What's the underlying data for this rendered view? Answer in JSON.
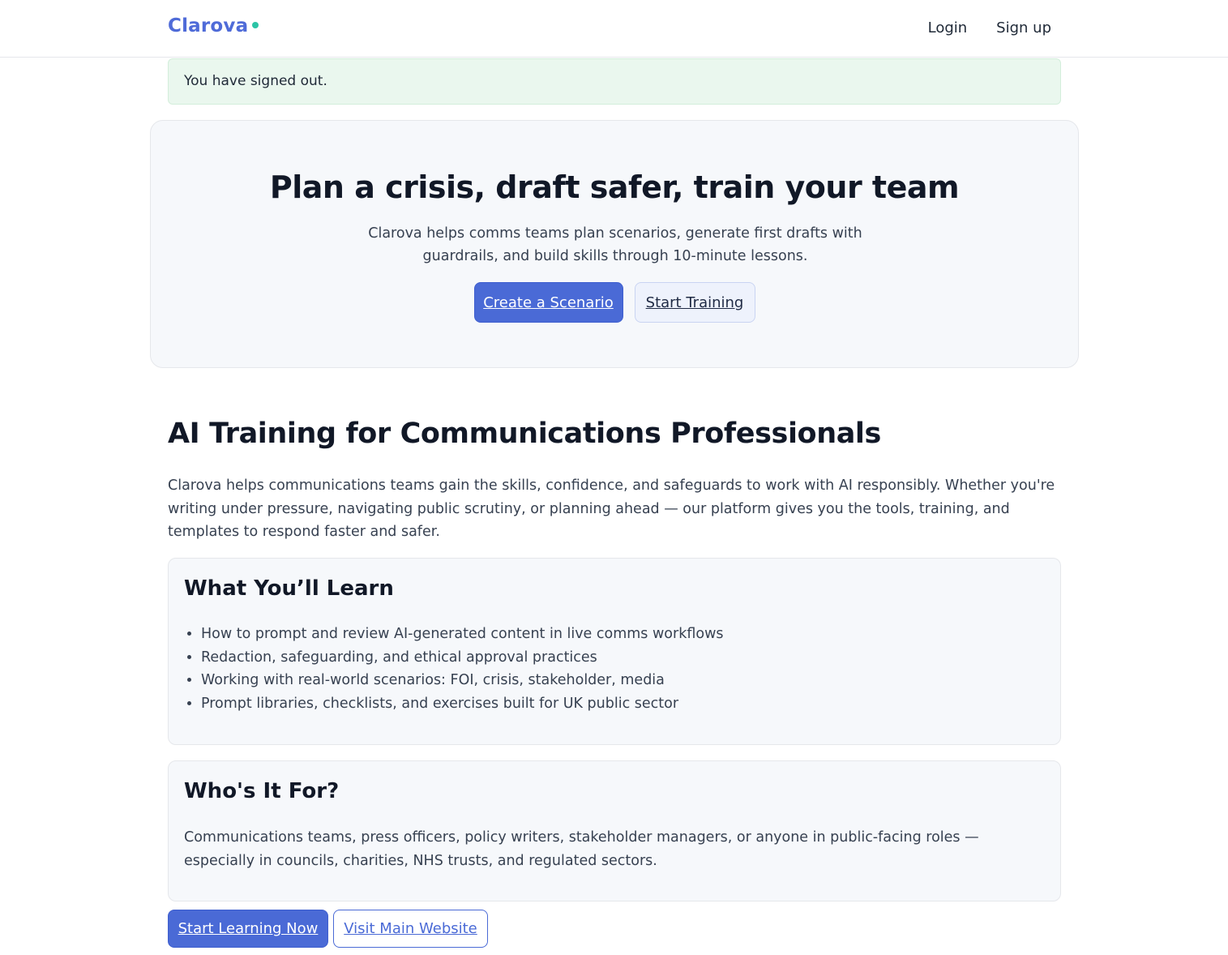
{
  "header": {
    "brand": "Clarova",
    "nav": [
      {
        "label": "Login"
      },
      {
        "label": "Sign up"
      }
    ]
  },
  "alert": {
    "message": "You have signed out."
  },
  "hero": {
    "title": "Plan a crisis, draft safer, train your team",
    "subtitle": "Clarova helps comms teams plan scenarios, generate first drafts with guardrails, and build skills through 10-minute lessons.",
    "primary_button": "Create a Scenario",
    "secondary_button": "Start Training"
  },
  "main": {
    "title": "AI Training for Communications Professionals",
    "intro": "Clarova helps communications teams gain the skills, confidence, and safeguards to work with AI responsibly. Whether you're writing under pressure, navigating public scrutiny, or planning ahead — our platform gives you the tools, training, and templates to respond faster and safer.",
    "learn": {
      "title": "What You’ll Learn",
      "items": [
        "How to prompt and review AI-generated content in live comms workflows",
        "Redaction, safeguarding, and ethical approval practices",
        "Working with real-world scenarios: FOI, crisis, stakeholder, media",
        "Prompt libraries, checklists, and exercises built for UK public sector"
      ]
    },
    "audience": {
      "title": "Who's It For?",
      "text": "Communications teams, press officers, policy writers, stakeholder managers, or anyone in public-facing roles — especially in councils, charities, NHS trusts, and regulated sectors."
    },
    "cta": {
      "primary": "Start Learning Now",
      "secondary": "Visit Main Website"
    }
  },
  "colors": {
    "accent": "#4a6ad6",
    "brand_dot": "#2cc4a6",
    "alert_bg": "#eaf7ee"
  }
}
